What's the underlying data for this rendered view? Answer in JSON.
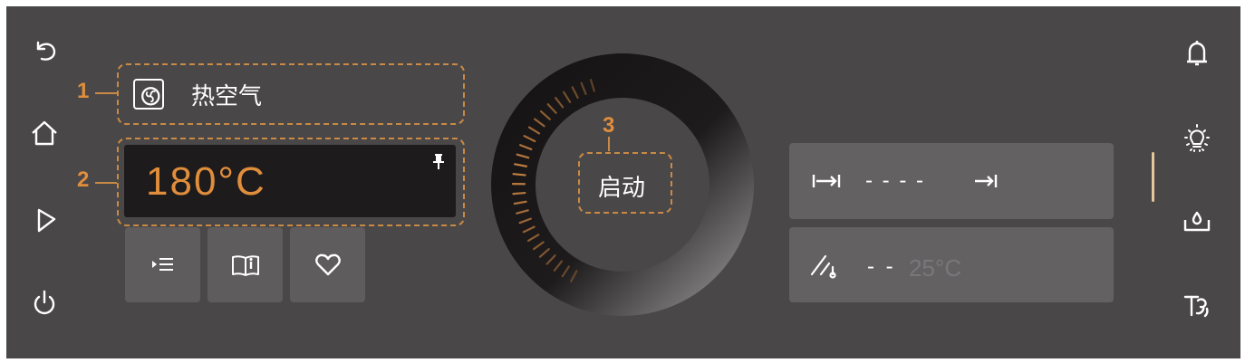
{
  "left_nav": {
    "back": "back-icon",
    "home": "home-icon",
    "play": "play-icon",
    "power": "power-icon"
  },
  "callouts": {
    "c1": "1",
    "c2": "2",
    "c3": "3"
  },
  "mode": {
    "icon": "fan-icon",
    "label": "热空气"
  },
  "temperature": {
    "value": "180°C",
    "pin_icon": "pin-icon"
  },
  "actions": [
    {
      "name": "program-list-button",
      "icon": "list-icon"
    },
    {
      "name": "recipe-book-button",
      "icon": "book-icon"
    },
    {
      "name": "favorite-button",
      "icon": "heart-icon"
    }
  ],
  "dial": {
    "start_label": "启动"
  },
  "duration": {
    "placeholder": "- - - -"
  },
  "probe": {
    "dashes": "- -",
    "temp": "25°C"
  },
  "right_nav": {
    "timer": "bell-icon",
    "light": "light-icon",
    "water": "water-tank-icon",
    "clean": "steam-clean-icon"
  },
  "colors": {
    "accent": "#e08e3c",
    "panel": "#4a4748",
    "display": "#1e1b1c"
  }
}
